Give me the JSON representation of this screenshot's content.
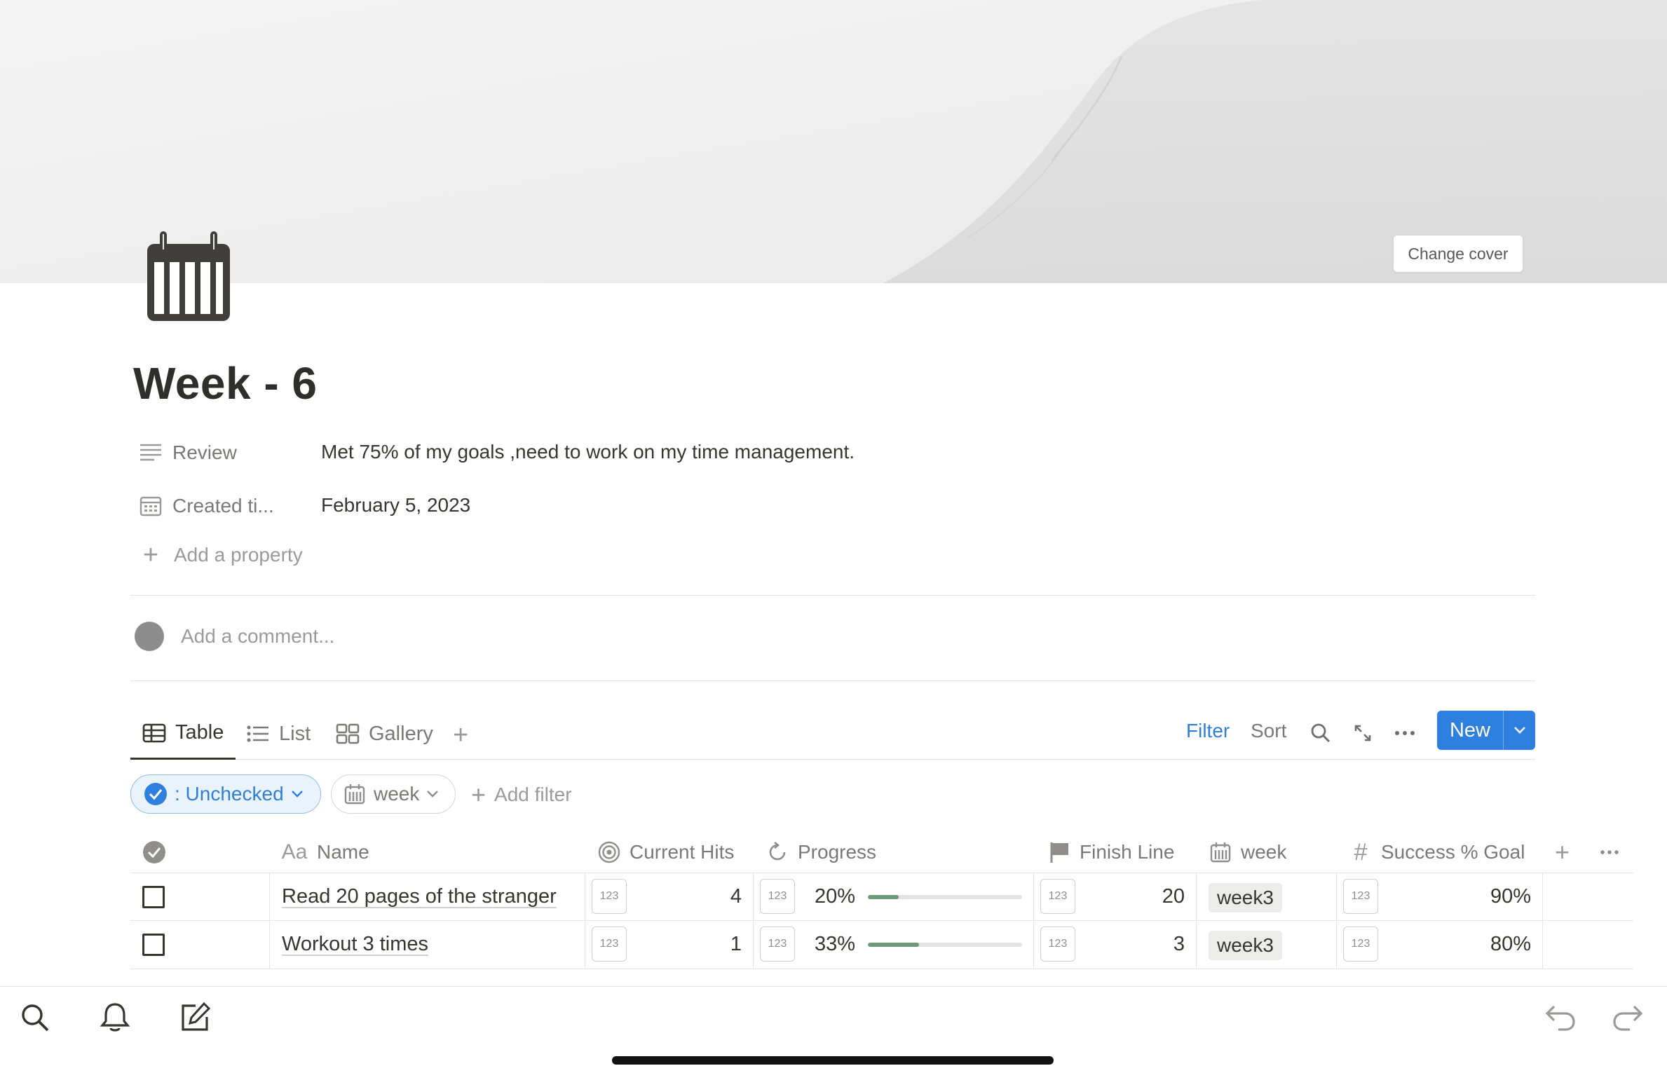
{
  "cover": {
    "change_cover_label": "Change cover"
  },
  "page": {
    "icon": "calendar-icon",
    "title": "Week - 6",
    "properties": [
      {
        "icon": "text-lines-icon",
        "label": "Review",
        "value": "Met 75% of my goals ,need to work on my time management."
      },
      {
        "icon": "calendar-small-icon",
        "label": "Created ti...",
        "value": "February 5, 2023"
      }
    ],
    "add_property_label": "Add a property",
    "comment_placeholder": "Add a comment..."
  },
  "views": {
    "tabs": [
      {
        "label": "Table",
        "icon": "table-icon",
        "active": true
      },
      {
        "label": "List",
        "icon": "list-icon",
        "active": false
      },
      {
        "label": "Gallery",
        "icon": "gallery-icon",
        "active": false
      }
    ],
    "filter_label": "Filter",
    "sort_label": "Sort",
    "new_label": "New",
    "accent_color": "#2f80de"
  },
  "filters": {
    "chips": [
      {
        "label": ": Unchecked",
        "icon": "check-circle-icon"
      },
      {
        "label": "week",
        "icon": "calendar-icon"
      }
    ],
    "add_filter_label": "Add filter"
  },
  "table": {
    "columns": [
      {
        "label": "Name",
        "icon": "text-aa-icon"
      },
      {
        "label": "Current Hits",
        "icon": "target-icon"
      },
      {
        "label": "Progress",
        "icon": "refresh-icon"
      },
      {
        "label": "Finish Line",
        "icon": "flag-icon"
      },
      {
        "label": "week",
        "icon": "calendar-icon"
      },
      {
        "label": "Success % Goal",
        "icon": "hash-icon"
      }
    ],
    "badge_label": "123",
    "rows": [
      {
        "name": "Read 20 pages of the stranger",
        "current_hits": "4",
        "progress_label": "20%",
        "progress": 0.2,
        "finish_line": "20",
        "week": "week3",
        "success_goal": "90%"
      },
      {
        "name": "Workout 3 times",
        "current_hits": "1",
        "progress_label": "33%",
        "progress": 0.33,
        "finish_line": "3",
        "week": "week3",
        "success_goal": "80%"
      }
    ],
    "progress_color": "#6f9a7a"
  },
  "bottom_bar": {
    "icons": [
      "search-icon",
      "bell-icon",
      "compose-icon",
      "undo-icon",
      "redo-icon"
    ]
  }
}
